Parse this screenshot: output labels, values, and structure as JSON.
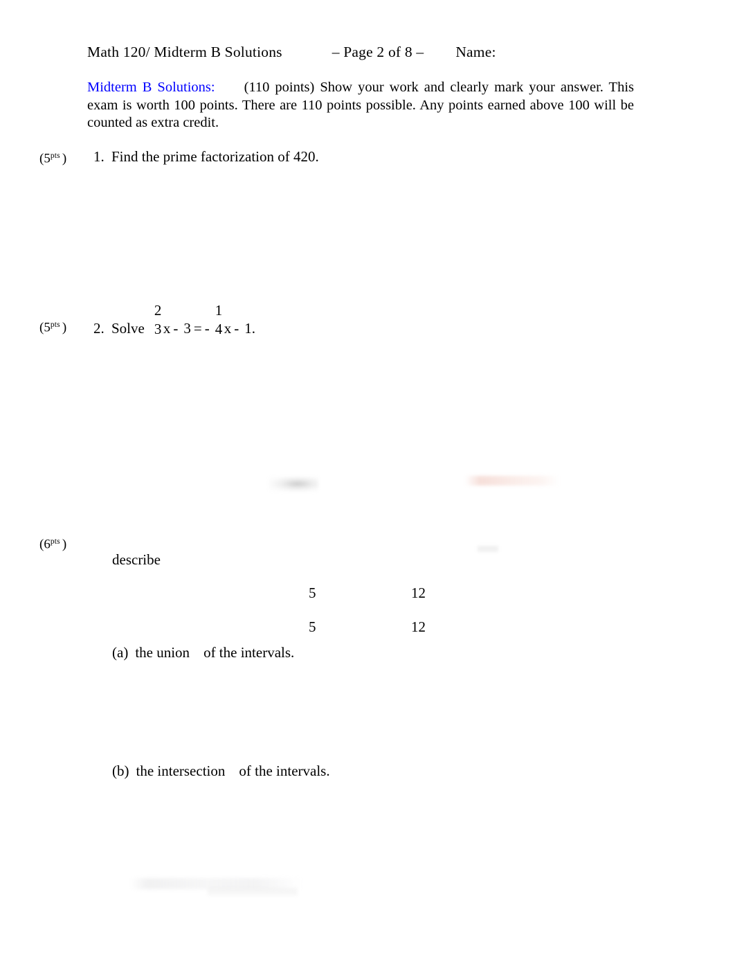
{
  "document": {
    "kind": "math-exam-page",
    "background_color": "#ffffff",
    "text_color": "#000000",
    "accent_color": "#0000ff"
  },
  "header": {
    "course_and_title": "Math 120/ Midterm B Solutions",
    "page_marker": "– Page 2 of 8 –",
    "name_label": "Name:"
  },
  "intro": {
    "lead": "Midterm B Solutions:",
    "body": "(110 points) Show your work and clearly mark your answer. This exam is worth 100 points. There are 110 points possible. Any points earned above 100 will be counted as extra credit."
  },
  "problems": [
    {
      "points_value": "5",
      "points_sup": "pts",
      "points_label_open": "(",
      "points_label_close": ")",
      "number": "1.",
      "text": "Find the prime factorization of 420."
    },
    {
      "points_value": "5",
      "points_sup": "pts",
      "points_label_open": "(",
      "points_label_close": ")",
      "number": "2.",
      "verb": "Solve",
      "equation": {
        "frac1": {
          "numerator": "2",
          "denominator": "3"
        },
        "term1_var": "x",
        "op1": "-",
        "const1": "3",
        "equals": "=",
        "sign2": "-",
        "frac2": {
          "numerator": "1",
          "denominator": "4"
        },
        "term2_var": "x",
        "op2": "-",
        "const2": "1."
      }
    },
    {
      "points_value": "6",
      "points_sup": "pts",
      "points_label_open": "(",
      "points_label_close": ")",
      "stem": "describe",
      "value_rows": [
        {
          "col1": "5",
          "col2": "12"
        },
        {
          "col1": "5",
          "col2": "12"
        }
      ],
      "parts": [
        {
          "marker": "(a)",
          "operation": "the union",
          "tail": "of the intervals."
        },
        {
          "marker": "(b)",
          "operation": "the intersection",
          "tail": "of the intervals."
        }
      ]
    }
  ]
}
